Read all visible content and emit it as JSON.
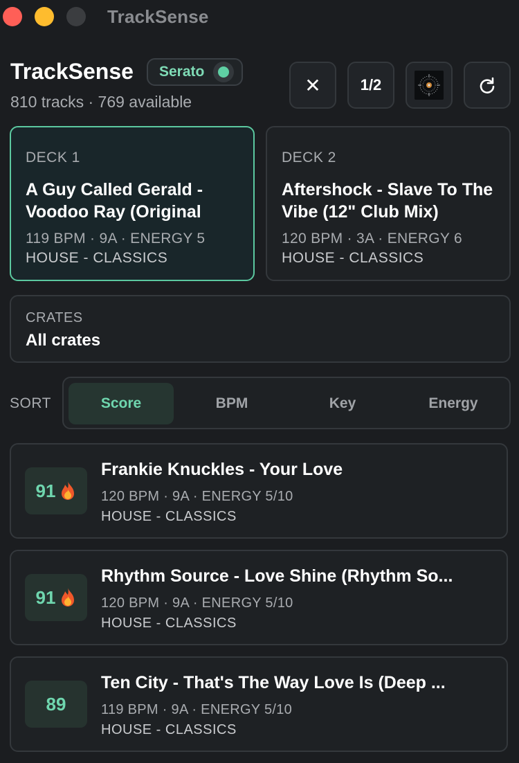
{
  "window": {
    "title": "TrackSense"
  },
  "header": {
    "app_name": "TrackSense",
    "source_label": "Serato",
    "stats": "810 tracks · 769 available"
  },
  "toolbar": {
    "close_label": "✕",
    "half_label": "1/2"
  },
  "decks": [
    {
      "label": "DECK 1",
      "title": "A Guy Called Gerald - Voodoo Ray (Original",
      "meta": "119 BPM · 9A · ENERGY 5",
      "genre": "HOUSE - CLASSICS"
    },
    {
      "label": "DECK 2",
      "title": "Aftershock - Slave To The Vibe (12\" Club Mix)",
      "meta": "120 BPM · 3A · ENERGY 6",
      "genre": "HOUSE - CLASSICS"
    }
  ],
  "crates": {
    "label": "CRATES",
    "value": "All crates"
  },
  "sort": {
    "label": "SORT",
    "options": [
      "Score",
      "BPM",
      "Key",
      "Energy"
    ],
    "selected": "Score"
  },
  "tracks": [
    {
      "score": "91",
      "hot": true,
      "title": "Frankie Knuckles - Your Love",
      "meta": "120 BPM · 9A · ENERGY 5/10",
      "genre": "HOUSE - CLASSICS"
    },
    {
      "score": "91",
      "hot": true,
      "title": "Rhythm Source - Love Shine (Rhythm So...",
      "meta": "120 BPM · 9A · ENERGY 5/10",
      "genre": "HOUSE - CLASSICS"
    },
    {
      "score": "89",
      "hot": false,
      "title": "Ten City - That's The Way Love Is (Deep ...",
      "meta": "119 BPM · 9A · ENERGY 5/10",
      "genre": "HOUSE - CLASSICS"
    }
  ],
  "colors": {
    "accent": "#5fd0a4",
    "background": "#1b1d20"
  }
}
